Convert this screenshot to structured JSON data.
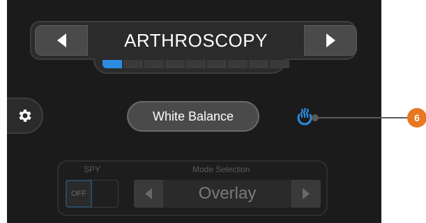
{
  "mode": {
    "title": "ARTHROSCOPY",
    "segments": {
      "total": 9,
      "active": 1
    }
  },
  "white_balance": {
    "label": "White Balance"
  },
  "spy": {
    "label": "SPY",
    "toggle_state": "OFF"
  },
  "mode_selection": {
    "label": "Mode Selection",
    "value": "Overlay"
  },
  "callout": {
    "number": "6"
  },
  "colors": {
    "accent": "#2c8ce0",
    "callout": "#e87722",
    "screen_bg": "#1b1b1b"
  },
  "icons": [
    "chevron-left-icon",
    "chevron-right-icon",
    "gear-icon",
    "heat-icon"
  ]
}
